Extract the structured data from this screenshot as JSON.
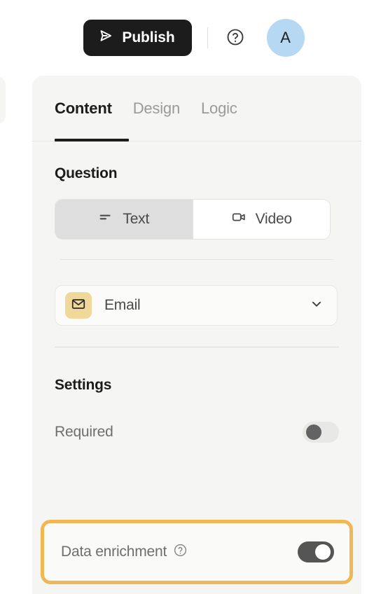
{
  "topbar": {
    "publish_label": "Publish",
    "publish_icon": "send-icon",
    "help_icon": "question-circle-icon",
    "avatar_initial": "A",
    "avatar_color": "#b6d8f2",
    "publish_bg": "#1c1c1c"
  },
  "tabs": [
    {
      "label": "Content",
      "active": true
    },
    {
      "label": "Design",
      "active": false
    },
    {
      "label": "Logic",
      "active": false
    }
  ],
  "question": {
    "title": "Question",
    "segments": [
      {
        "label": "Text",
        "icon": "text-lines-icon",
        "selected": true
      },
      {
        "label": "Video",
        "icon": "video-camera-icon",
        "selected": false
      }
    ],
    "field_type": {
      "label": "Email",
      "icon": "envelope-icon",
      "badge_color": "#f0d79a",
      "chevron": "chevron-down-icon"
    }
  },
  "settings": {
    "title": "Settings",
    "rows": [
      {
        "label": "Required",
        "toggle": "off",
        "has_help": false
      },
      {
        "label": "Data enrichment",
        "toggle": "on",
        "has_help": true,
        "help_icon": "question-circle-icon",
        "highlighted": true
      }
    ],
    "highlight_color": "#f0b754"
  }
}
